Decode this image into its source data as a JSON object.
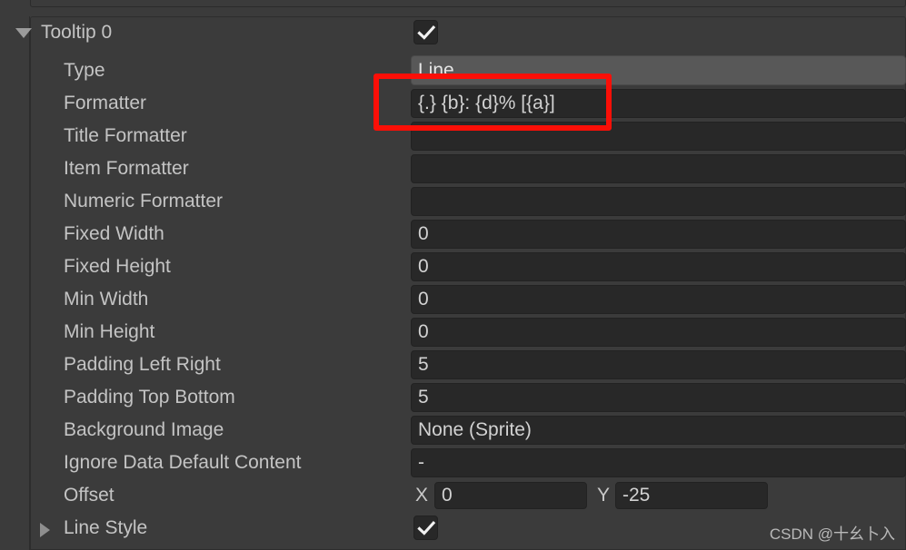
{
  "panel": {
    "title": "Tooltip 0",
    "expanded": true,
    "enabled": true,
    "checkbox_icon": "checkmark-icon",
    "foldout_open_icon": "triangle-down-icon",
    "foldout_closed_icon": "triangle-right-icon"
  },
  "annotation": {
    "type": "rectangle-highlight",
    "color": "#fb0f07",
    "targets": "formatter-row"
  },
  "rows": [
    {
      "label": "Type",
      "control": "dropdown",
      "value": "Line",
      "name": "type"
    },
    {
      "label": "Formatter",
      "control": "text",
      "value": "{.} {b}:  {d}% [{a}]",
      "name": "formatter"
    },
    {
      "label": "Title Formatter",
      "control": "text",
      "value": "",
      "name": "title-formatter"
    },
    {
      "label": "Item Formatter",
      "control": "text",
      "value": "",
      "name": "item-formatter"
    },
    {
      "label": "Numeric Formatter",
      "control": "text",
      "value": "",
      "name": "numeric-formatter"
    },
    {
      "label": "Fixed Width",
      "control": "text",
      "value": "0",
      "name": "fixed-width"
    },
    {
      "label": "Fixed Height",
      "control": "text",
      "value": "0",
      "name": "fixed-height"
    },
    {
      "label": "Min Width",
      "control": "text",
      "value": "0",
      "name": "min-width"
    },
    {
      "label": "Min Height",
      "control": "text",
      "value": "0",
      "name": "min-height"
    },
    {
      "label": "Padding Left Right",
      "control": "text",
      "value": "5",
      "name": "padding-left-right"
    },
    {
      "label": "Padding Top Bottom",
      "control": "text",
      "value": "5",
      "name": "padding-top-bottom"
    },
    {
      "label": "Background Image",
      "control": "object",
      "value": "None (Sprite)",
      "name": "background-image"
    },
    {
      "label": "Ignore Data Default Content",
      "control": "text",
      "value": "-",
      "name": "ignore-data-default-content"
    }
  ],
  "offset": {
    "label": "Offset",
    "x_label": "X",
    "x_value": "0",
    "y_label": "Y",
    "y_value": "-25"
  },
  "line_style": {
    "label": "Line Style",
    "enabled": true,
    "expanded": false
  },
  "watermark": {
    "text": "CSDN @十幺卜入"
  }
}
